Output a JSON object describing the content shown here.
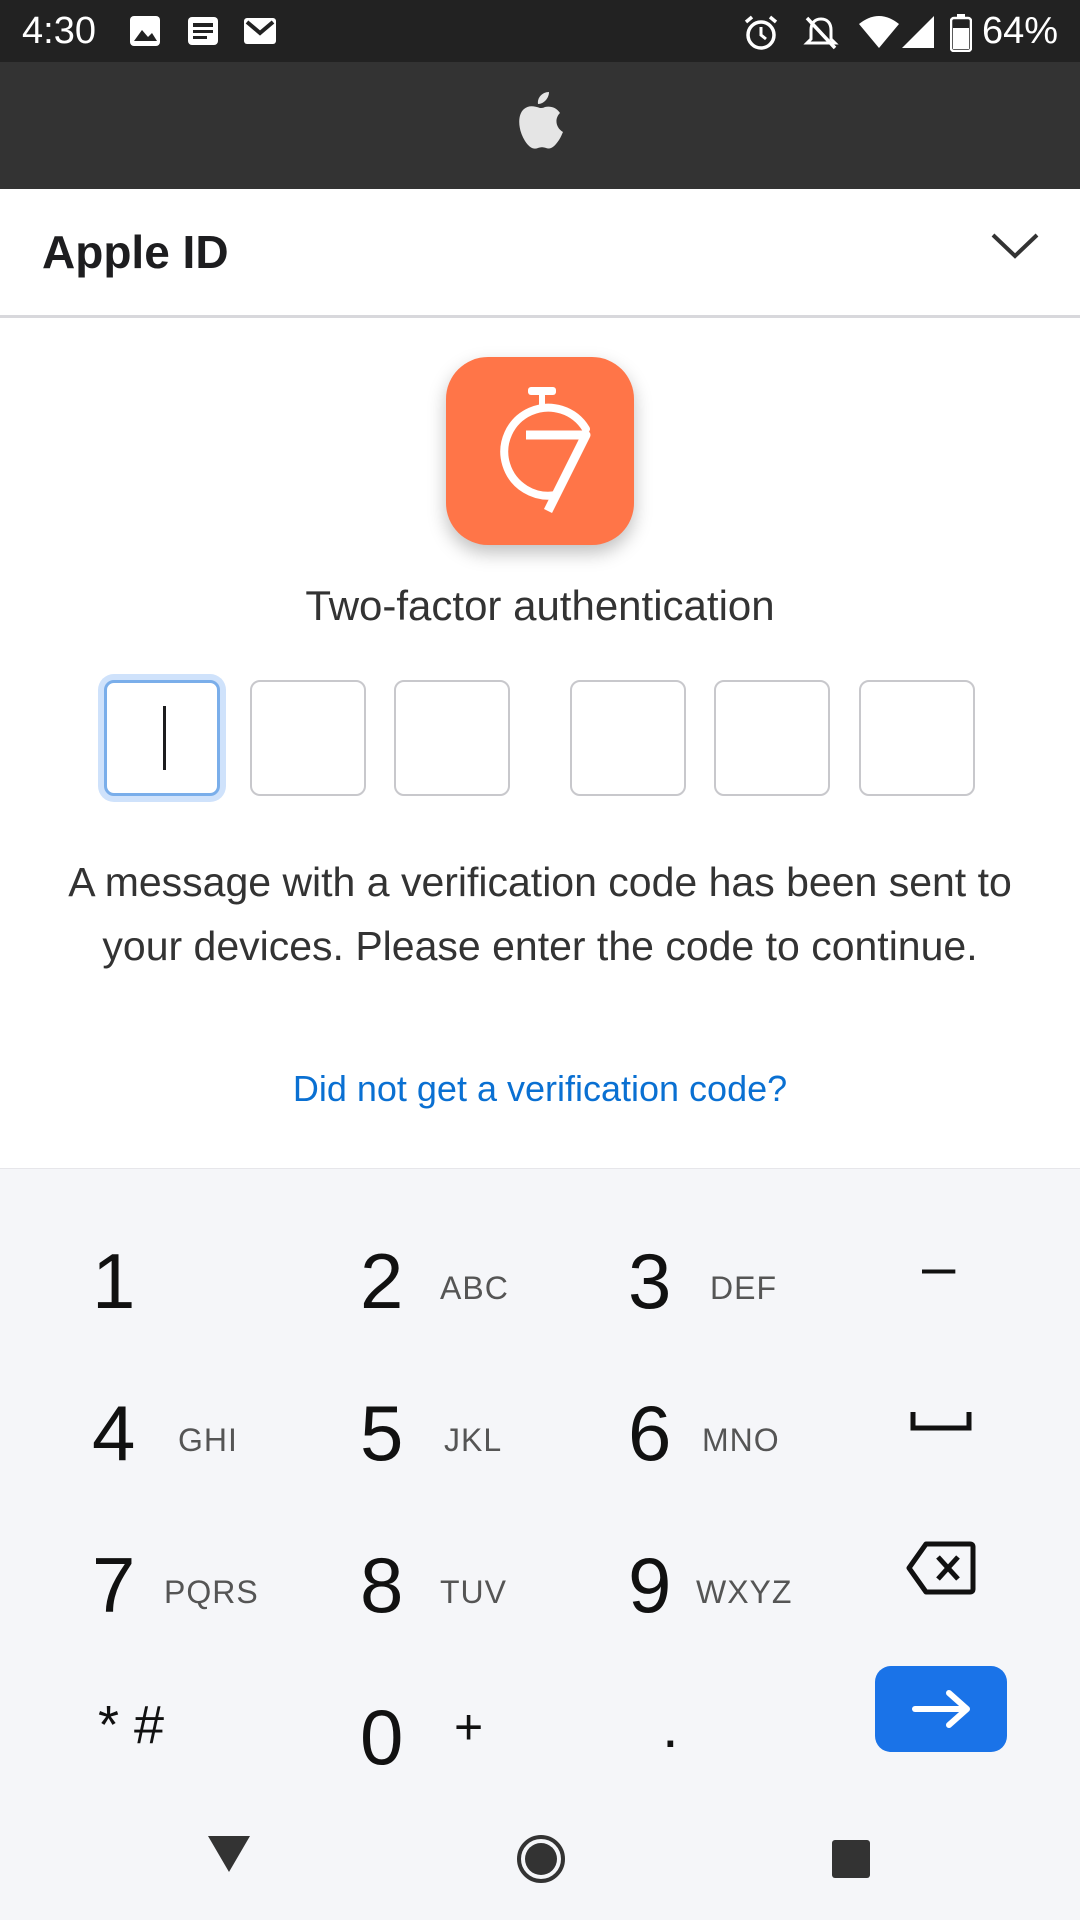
{
  "status_bar": {
    "time": "4:30",
    "battery": "64%",
    "icons": [
      "image-icon",
      "news-icon",
      "gmail-icon",
      "alarm-icon",
      "bell-off-icon",
      "wifi-icon",
      "signal-icon",
      "battery-icon"
    ]
  },
  "header": {
    "logo": "apple-logo-icon",
    "title": "Apple ID"
  },
  "app_icon": {
    "icon": "stopwatch-seven-icon",
    "color": "#ff7548"
  },
  "auth": {
    "heading": "Two-factor authentication",
    "code_digits": [
      "",
      "",
      "",
      "",
      "",
      ""
    ],
    "message": "A message with a verification code has been sent to your devices. Please enter the code to continue.",
    "help_link": "Did not get a verification code?"
  },
  "keypad": {
    "keys": [
      {
        "digit": "1",
        "letters": ""
      },
      {
        "digit": "2",
        "letters": "ABC"
      },
      {
        "digit": "3",
        "letters": "DEF"
      },
      {
        "digit": "4",
        "letters": "GHI"
      },
      {
        "digit": "5",
        "letters": "JKL"
      },
      {
        "digit": "6",
        "letters": "MNO"
      },
      {
        "digit": "7",
        "letters": "PQRS"
      },
      {
        "digit": "8",
        "letters": "TUV"
      },
      {
        "digit": "9",
        "letters": "WXYZ"
      },
      {
        "digit": "0",
        "letters": "+"
      }
    ],
    "symbols": {
      "minus": "–",
      "star_hash": "* #",
      "period": "."
    },
    "accent": "#1a73e8"
  },
  "nav_bar": {
    "icons": [
      "back-triangle-icon",
      "home-circle-icon",
      "recents-square-icon"
    ]
  }
}
